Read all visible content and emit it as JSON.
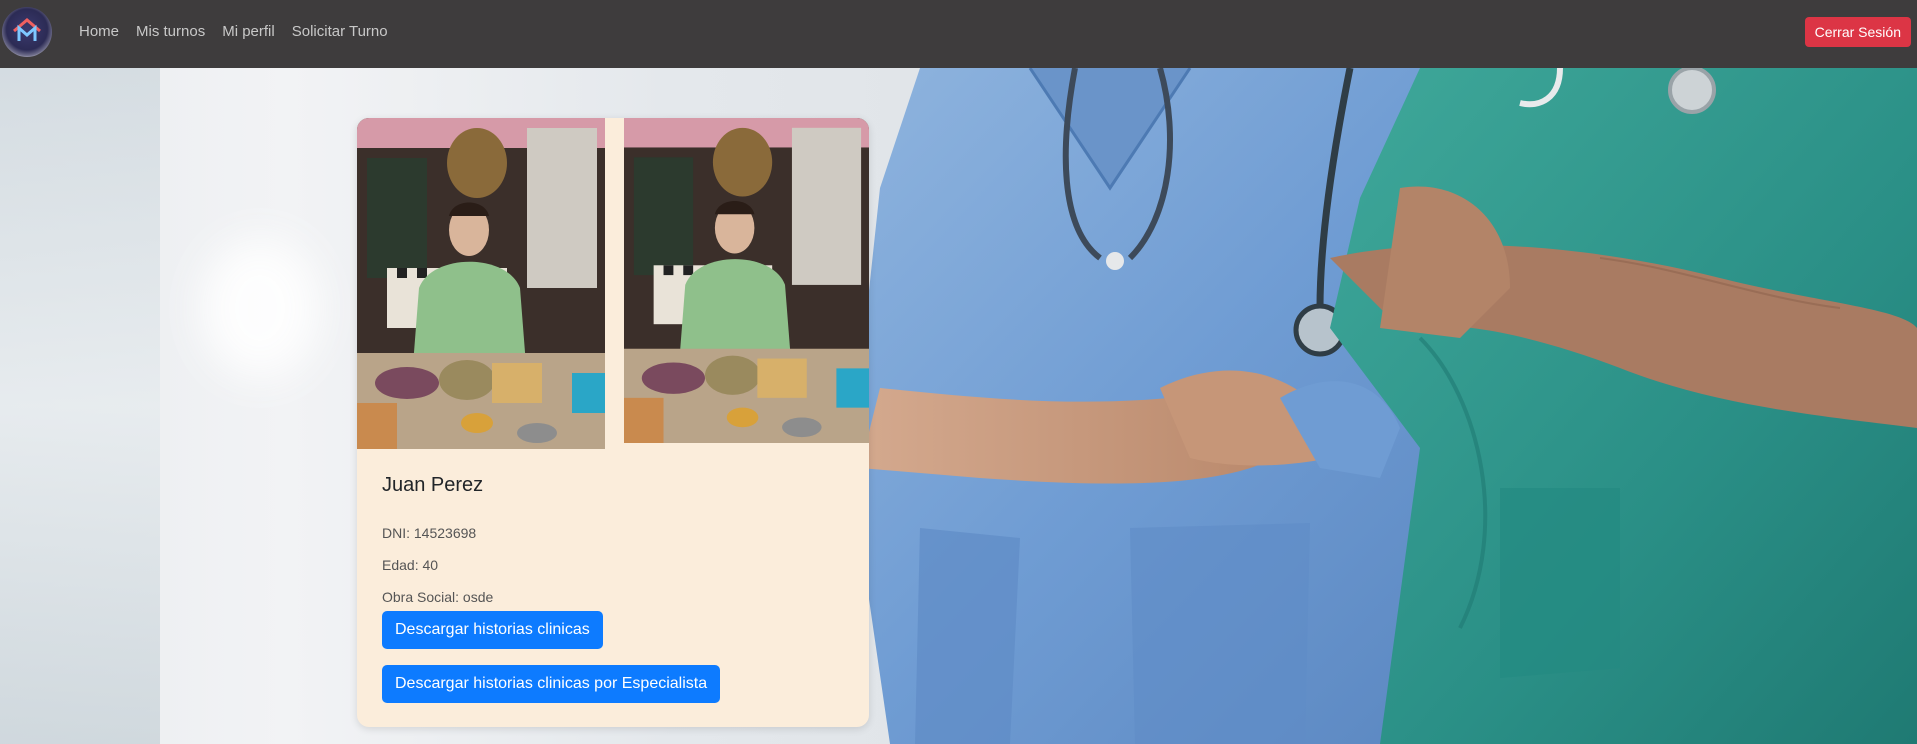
{
  "nav": {
    "links": [
      "Home",
      "Mis turnos",
      "Mi perfil",
      "Solicitar Turno"
    ],
    "logout_label": "Cerrar Sesión"
  },
  "profile": {
    "name": "Juan Perez",
    "dni": "DNI: 14523698",
    "age": "Edad: 40",
    "obra_social": "Obra Social: osde",
    "download_button": "Descargar historias clinicas",
    "download_by_specialist_button": "Descargar historias clinicas por Especialista"
  },
  "colors": {
    "navbar": "#3e3c3d",
    "logout": "#dc3545",
    "primary_button": "#0d7bff",
    "card": "#fbeddb"
  }
}
